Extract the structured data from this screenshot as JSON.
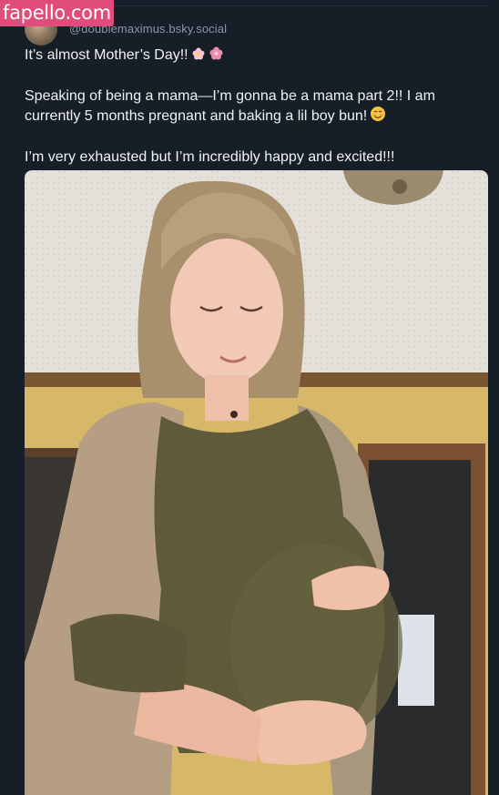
{
  "watermark": {
    "text": "fapello.com"
  },
  "post": {
    "author_handle": "@doublemaximus.bsky.social",
    "paragraphs": [
      "It’s almost Mother’s Day!!",
      "Speaking of being a mama—I’m gonna be a mama part 2!! I am currently 5 months pregnant and baking a lil boy bun!",
      "I’m very exhausted but I’m incredibly happy and excited!!!"
    ],
    "icons": [
      "avatar-image",
      "blossom-icon",
      "cherry-blossom-icon",
      "smiling-face-icon"
    ]
  },
  "colors": {
    "background": "#161e27",
    "text": "#f1f3f5",
    "handle": "#8b98a5",
    "watermark_bg": "#e14d7b"
  }
}
